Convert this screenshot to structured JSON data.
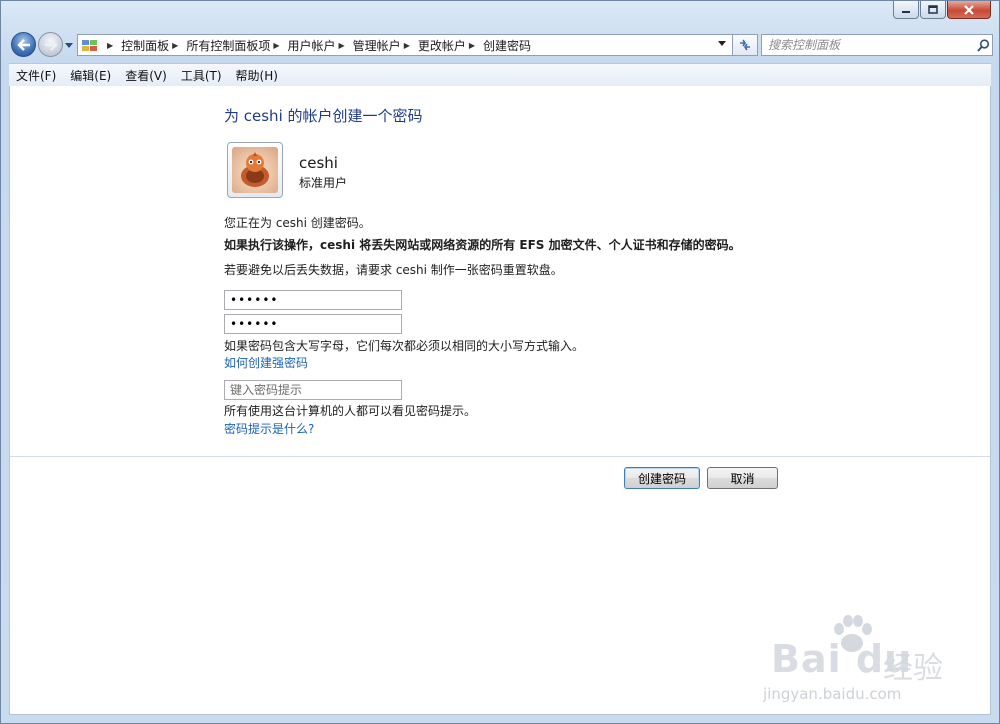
{
  "navigation": {
    "breadcrumbs": [
      "控制面板",
      "所有控制面板项",
      "用户帐户",
      "管理帐户",
      "更改帐户",
      "创建密码"
    ],
    "search_placeholder": "搜索控制面板"
  },
  "menu": [
    "文件(F)",
    "编辑(E)",
    "查看(V)",
    "工具(T)",
    "帮助(H)"
  ],
  "page": {
    "title": "为 ceshi 的帐户创建一个密码",
    "user": {
      "name": "ceshi",
      "type": "标准用户"
    },
    "info_line": "您正在为 ceshi 创建密码。",
    "warning_line": "如果执行该操作，ceshi 将丢失网站或网络资源的所有 EFS 加密文件、个人证书和存储的密码。",
    "advice_line": "若要避免以后丢失数据，请要求 ceshi 制作一张密码重置软盘。",
    "password_value": "123456",
    "confirm_value": "123456",
    "case_note": "如果密码包含大写字母，它们每次都必须以相同的大小写方式输入。",
    "strong_password_link": "如何创建强密码",
    "hint_placeholder": "键入密码提示",
    "hint_note": "所有使用这台计算机的人都可以看见密码提示。",
    "hint_link": "密码提示是什么?",
    "create_button": "创建密码",
    "cancel_button": "取消"
  },
  "watermark": {
    "brand": "Bai du",
    "brand_cn": "经验",
    "url": "jingyan.baidu.com"
  },
  "colors": {
    "title": "#1f3c88",
    "link": "#1a63b8",
    "accent": "#3c7fb1"
  }
}
